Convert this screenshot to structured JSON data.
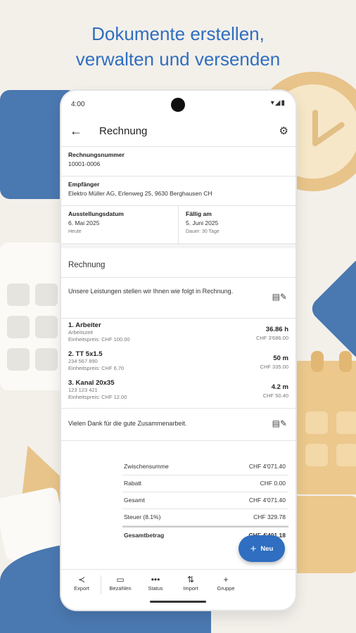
{
  "headline": {
    "line1": "Dokumente erstellen,",
    "line2": "verwalten und versenden"
  },
  "status": {
    "time": "4:00",
    "icons": "▾◢▮"
  },
  "appbar": {
    "title": "Rechnung",
    "back_icon": "arrow-left-icon",
    "settings_icon": "gear-icon"
  },
  "fields": {
    "number": {
      "label": "Rechnungsnummer",
      "value": "10001-0006"
    },
    "recipient": {
      "label": "Empfänger",
      "value": "Elektro Müller AG, Erlenweg 25, 9630 Berghausen CH"
    },
    "issue_date": {
      "label": "Ausstellungsdatum",
      "value": "6. Mai 2025",
      "sub": "Heute"
    },
    "due_date": {
      "label": "Fällig am",
      "value": "5. Juni 2025",
      "sub": "Dauer: 30 Tage"
    }
  },
  "section_title": "Rechnung",
  "intro_text": "Unsere Leistungen stellen wir Ihnen wie folgt in Rechnung.",
  "items": [
    {
      "name": "1. Arbeiter",
      "d1": "Arbeitszeit",
      "d2": "Einheitspreis: CHF 100.00",
      "qty": "36.86 h",
      "price": "CHF 3'686.00"
    },
    {
      "name": "2. TT 5x1.5",
      "d1": "234 567 890",
      "d2": "Einheitspreis: CHF 6.70",
      "qty": "50 m",
      "price": "CHF 335.00"
    },
    {
      "name": "3. Kanal 20x35",
      "d1": "123 123 421",
      "d2": "Einheitspreis: CHF 12.00",
      "qty": "4.2 m",
      "price": "CHF 50.40"
    }
  ],
  "thanks_text": "Vielen Dank für die gute Zusammenarbeit.",
  "totals": [
    {
      "label": "Zwischensumme",
      "value": "CHF 4'071.40"
    },
    {
      "label": "Rabatt",
      "value": "CHF 0.00"
    },
    {
      "label": "Gesamt",
      "value": "CHF 4'071.40"
    },
    {
      "label": "Steuer (8.1%)",
      "value": "CHF 329.78"
    },
    {
      "label": "Gesamtbetrag",
      "value": "CHF 4'401.18"
    }
  ],
  "fab": {
    "label": "Neu"
  },
  "bottom_tabs": [
    {
      "label": "Export",
      "icon": "share-icon"
    },
    {
      "label": "Bezahlen",
      "icon": "card-icon"
    },
    {
      "label": "Status",
      "icon": "more-icon"
    },
    {
      "label": "Import",
      "icon": "import-icon"
    },
    {
      "label": "Gruppe",
      "icon": "plus-icon"
    }
  ],
  "colors": {
    "accent": "#2f6ec0",
    "background": "#f3f0ea"
  }
}
